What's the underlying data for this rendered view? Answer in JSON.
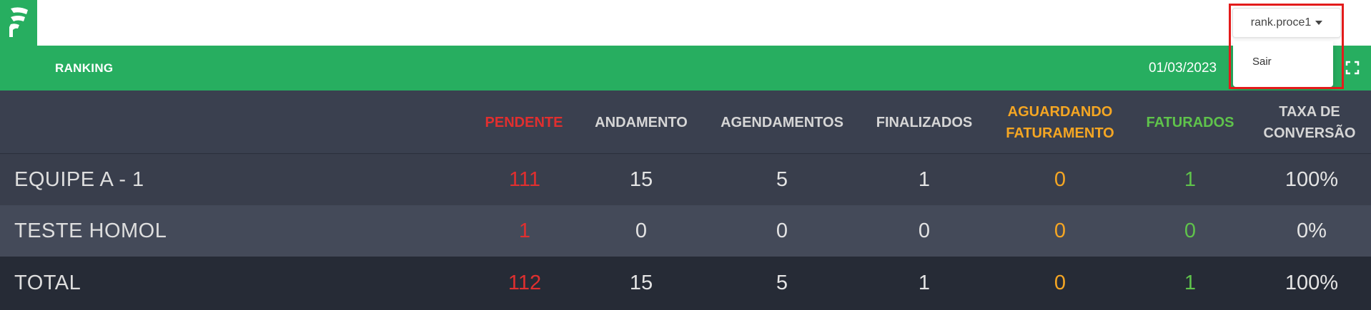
{
  "user": {
    "name": "rank.proce1",
    "menu": [
      "Sair"
    ]
  },
  "header": {
    "title": "RANKING",
    "date": "01/03/2023"
  },
  "colors": {
    "brand_green": "#27ae60",
    "pendente": "#e02f2f",
    "aguardando": "#f5a623",
    "faturados": "#5fc34b",
    "highlight": "#e31b1b"
  },
  "table": {
    "columns": [
      {
        "label": "PENDENTE",
        "color": "red"
      },
      {
        "label": "ANDAMENTO",
        "color": "default"
      },
      {
        "label": "AGENDAMENTOS",
        "color": "default"
      },
      {
        "label": "FINALIZADOS",
        "color": "default"
      },
      {
        "label": "AGUARDANDO FATURAMENTO",
        "color": "orange"
      },
      {
        "label": "FATURADOS",
        "color": "green"
      },
      {
        "label": "TAXA DE CONVERSÃO",
        "color": "default"
      }
    ],
    "rows": [
      {
        "team": "EQUIPE A - 1",
        "values": [
          "111",
          "15",
          "5",
          "1",
          "0",
          "1",
          "100%"
        ]
      },
      {
        "team": "TESTE HOMOL",
        "values": [
          "1",
          "0",
          "0",
          "0",
          "0",
          "0",
          "0%"
        ]
      }
    ],
    "total": {
      "label": "TOTAL",
      "values": [
        "112",
        "15",
        "5",
        "1",
        "0",
        "1",
        "100%"
      ]
    }
  },
  "icons": {
    "logo": "brand-logo-icon",
    "fullscreen": "fullscreen-icon",
    "caret": "caret-down-icon"
  }
}
